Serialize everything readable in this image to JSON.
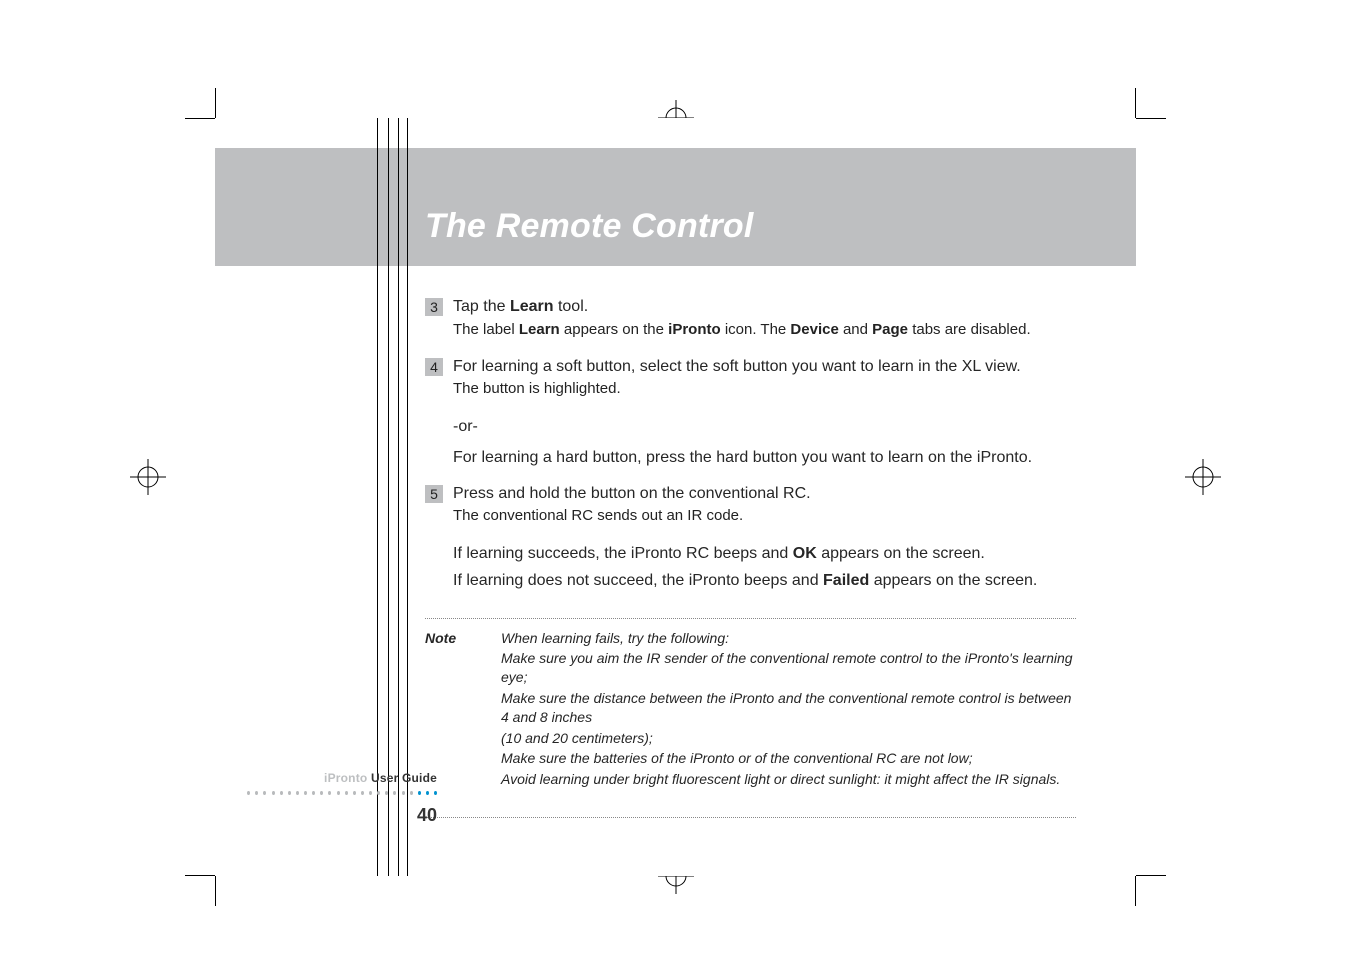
{
  "header": {
    "title": "The Remote Control"
  },
  "steps": {
    "s3": {
      "num": "3",
      "line1_a": "Tap the ",
      "line1_b": "Learn",
      "line1_c": " tool.",
      "line2_a": "The label ",
      "line2_b": "Learn",
      "line2_c": " appears on the ",
      "line2_d": "iPronto",
      "line2_e": " icon. The ",
      "line2_f": "Device",
      "line2_g": " and ",
      "line2_h": "Page",
      "line2_i": " tabs are disabled."
    },
    "s4": {
      "num": "4",
      "line1": "For learning a soft button, select the soft button you want to learn in the XL view.",
      "line2": "The button is highlighted."
    },
    "or": "-or-",
    "hard": "For learning a hard button, press the hard button you want to learn on the iPronto.",
    "s5": {
      "num": "5",
      "line1": "Press and hold the button on the conventional RC.",
      "line2": "The conventional RC sends out an IR code."
    },
    "if1_a": "If learning succeeds, the iPronto RC beeps and ",
    "if1_b": "OK",
    "if1_c": " appears on the screen.",
    "if2_a": "If learning does not succeed, the iPronto beeps and ",
    "if2_b": "Failed",
    "if2_c": " appears on the screen."
  },
  "note": {
    "label": "Note",
    "intro": "When learning fails, try the following:",
    "items": [
      "Make sure you aim the IR sender of the conventional remote control to the iPronto's learning eye;",
      "Make sure the distance between the iPronto and the conventional remote control is between 4 and 8 inches",
      "(10 and 20 centimeters);",
      "Make sure the batteries of the iPronto or of the conventional RC are not low;",
      "Avoid learning under bright fluorescent light or direct sunlight: it might affect the IR signals."
    ]
  },
  "footer": {
    "brand": "iPronto",
    "ug": " User Guide",
    "page": "40"
  }
}
